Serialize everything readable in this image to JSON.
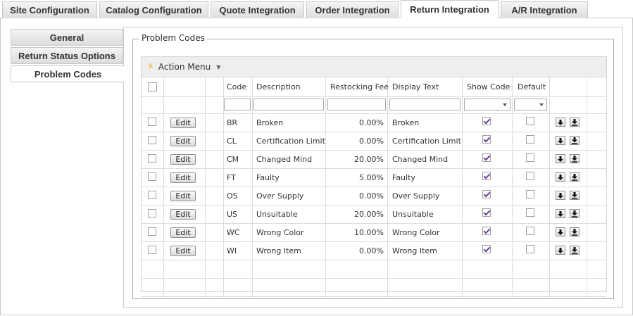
{
  "top_tabs": [
    {
      "label": "Site Configuration"
    },
    {
      "label": "Catalog Configuration"
    },
    {
      "label": "Quote Integration"
    },
    {
      "label": "Order Integration"
    },
    {
      "label": "Return Integration"
    },
    {
      "label": "A/R Integration"
    }
  ],
  "active_top_tab": "Return Integration",
  "side_tabs": [
    {
      "label": "General"
    },
    {
      "label": "Return Status Options"
    },
    {
      "label": "Problem Codes"
    }
  ],
  "active_side_tab": "Problem Codes",
  "fieldset_legend": "Problem Codes",
  "toolbar": {
    "action_menu": "Action Menu"
  },
  "columns": {
    "code": "Code",
    "description": "Description",
    "restocking_fee": "Restocking Fee",
    "display_text": "Display Text",
    "show_code": "Show Code",
    "default": "Default"
  },
  "edit_label": "Edit",
  "rows": [
    {
      "code": "BR",
      "description": "Broken",
      "fee": "0.00%",
      "display": "Broken",
      "show": true,
      "default": false
    },
    {
      "code": "CL",
      "description": "Certification Limit",
      "fee": "0.00%",
      "display": "Certification Limit",
      "show": true,
      "default": false
    },
    {
      "code": "CM",
      "description": "Changed Mind",
      "fee": "20.00%",
      "display": "Changed Mind",
      "show": true,
      "default": false
    },
    {
      "code": "FT",
      "description": "Faulty",
      "fee": "5.00%",
      "display": "Faulty",
      "show": true,
      "default": false
    },
    {
      "code": "OS",
      "description": "Over Supply",
      "fee": "0.00%",
      "display": "Over Supply",
      "show": true,
      "default": false
    },
    {
      "code": "US",
      "description": "Unsuitable",
      "fee": "20.00%",
      "display": "Unsuitable",
      "show": true,
      "default": false
    },
    {
      "code": "WC",
      "description": "Wrong Color",
      "fee": "10.00%",
      "display": "Wrong Color",
      "show": true,
      "default": false
    },
    {
      "code": "WI",
      "description": "Wrong Item",
      "fee": "0.00%",
      "display": "Wrong Item",
      "show": true,
      "default": false
    }
  ],
  "icons": {
    "action": "lightning-bolt-icon",
    "row_move": "arrow-down-icon",
    "row_move_bottom": "arrow-to-bottom-icon"
  },
  "colors": {
    "check": "#6b3fa0",
    "bolt": "#f0a800"
  }
}
